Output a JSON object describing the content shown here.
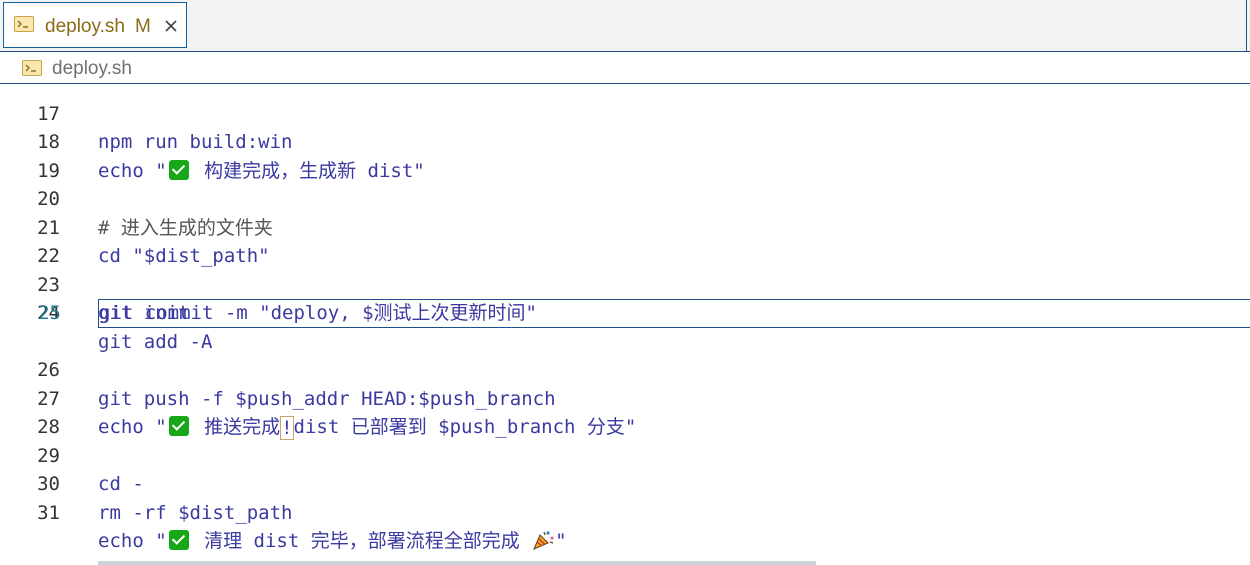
{
  "tab": {
    "filename": "deploy.sh",
    "status": "M",
    "icon": "terminal-file-icon"
  },
  "breadcrumb": {
    "filename": "deploy.sh"
  },
  "colors": {
    "accent_border": "#1f4e8c",
    "check_green": "#18a718",
    "keyword": "#3a3aa0"
  },
  "editor": {
    "current_line": 25,
    "lines": [
      {
        "num": "17",
        "text": "npm run build:win"
      },
      {
        "num": "18",
        "text_a": "echo \"",
        "text_b": " 构建完成，生成新 dist\""
      },
      {
        "num": "19",
        "text": ""
      },
      {
        "num": "20",
        "text": "# 进入生成的文件夹"
      },
      {
        "num": "21",
        "text": "cd \"$dist_path\""
      },
      {
        "num": "22",
        "text": ""
      },
      {
        "num": "23",
        "text": "git init"
      },
      {
        "num": "24",
        "text": "git add -A"
      },
      {
        "num": "25",
        "text": "git commit -m \"deploy, $测试上次更新时间\""
      },
      {
        "num": "26",
        "text": "git push -f $push_addr HEAD:$push_branch"
      },
      {
        "num": "27",
        "text_a": "echo \"",
        "text_b": " 推送完成",
        "text_c": "!",
        "text_d": "dist 已部署到 $push_branch 分支\""
      },
      {
        "num": "28",
        "text": ""
      },
      {
        "num": "29",
        "text": "cd -"
      },
      {
        "num": "30",
        "text": "rm -rf $dist_path"
      },
      {
        "num": "31",
        "text_a": "echo \"",
        "text_b": " 清理 dist 完毕，部署流程全部完成 ",
        "text_c": "\""
      }
    ]
  }
}
